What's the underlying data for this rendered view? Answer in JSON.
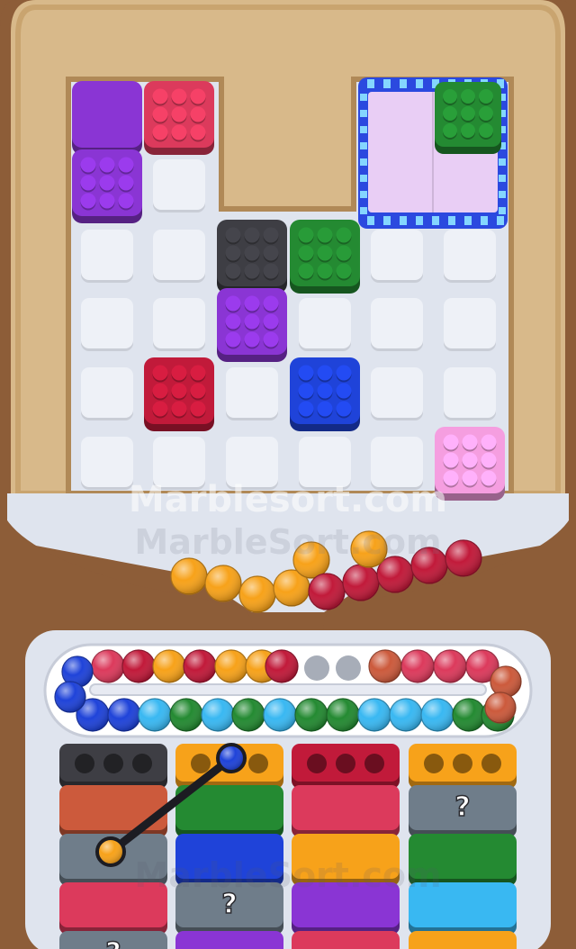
{
  "watermarks": {
    "primary": "Marblesort.com",
    "secondary": "MarbleSort.com",
    "bottom": "MarbleSort.com"
  },
  "colors": {
    "wood": "#8d5d38",
    "tray": "#d8b98a",
    "floor": "#dfe4ee",
    "empty_cell": "#eef1f7",
    "purple": "#8a35d4",
    "red": "#dc3a5c",
    "crimson": "#c11a3a",
    "green": "#248a32",
    "black": "#3e3e44",
    "blue": "#1f43d9",
    "pink": "#f59ee0",
    "lavender": "#e9cef5",
    "stripe_blue": "#2b49df",
    "stripe_light": "#84d6ff",
    "orange": "#f7a21a",
    "light_blue": "#39b8f2",
    "brick": "#cc5a3c",
    "gray": "#6f7d8a",
    "dark_slot": "#3c3c44"
  },
  "grid_board": {
    "tiles": [
      {
        "row": 0,
        "col": 0,
        "color": "purple",
        "studs": false
      },
      {
        "row": 0,
        "col": 1,
        "color": "red",
        "studs": true
      },
      {
        "row": 1,
        "col": 0,
        "color": "purple",
        "studs": true
      },
      {
        "row": 1,
        "col": 1,
        "color": "empty"
      },
      {
        "row": 2,
        "col": 0,
        "color": "empty"
      },
      {
        "row": 2,
        "col": 1,
        "color": "empty"
      },
      {
        "row": 2,
        "col": 2,
        "color": "black",
        "studs": true
      },
      {
        "row": 2,
        "col": 3,
        "color": "green",
        "studs": true
      },
      {
        "row": 2,
        "col": 4,
        "color": "empty"
      },
      {
        "row": 2,
        "col": 5,
        "color": "empty"
      },
      {
        "row": 3,
        "col": 0,
        "color": "empty"
      },
      {
        "row": 3,
        "col": 1,
        "color": "empty"
      },
      {
        "row": 3,
        "col": 2,
        "color": "purple",
        "studs": true
      },
      {
        "row": 3,
        "col": 3,
        "color": "empty"
      },
      {
        "row": 3,
        "col": 4,
        "color": "empty"
      },
      {
        "row": 3,
        "col": 5,
        "color": "empty"
      },
      {
        "row": 4,
        "col": 0,
        "color": "empty"
      },
      {
        "row": 4,
        "col": 1,
        "color": "crimson",
        "studs": true
      },
      {
        "row": 4,
        "col": 2,
        "color": "empty"
      },
      {
        "row": 4,
        "col": 3,
        "color": "blue",
        "studs": true
      },
      {
        "row": 4,
        "col": 4,
        "color": "empty"
      },
      {
        "row": 4,
        "col": 5,
        "color": "empty"
      },
      {
        "row": 5,
        "col": 0,
        "color": "empty"
      },
      {
        "row": 5,
        "col": 1,
        "color": "empty"
      },
      {
        "row": 5,
        "col": 2,
        "color": "empty"
      },
      {
        "row": 5,
        "col": 3,
        "color": "empty"
      },
      {
        "row": 5,
        "col": 4,
        "color": "empty"
      },
      {
        "row": 5,
        "col": 5,
        "color": "pink",
        "studs": true
      }
    ],
    "locked_box": {
      "top_right_tile": "green"
    }
  },
  "marble_hopper": {
    "balls": [
      "orange",
      "orange",
      "orange",
      "orange",
      "orange",
      "crimson",
      "crimson",
      "crimson",
      "crimson",
      "crimson",
      "orange",
      "orange"
    ]
  },
  "conveyor": {
    "top_row": [
      "red",
      "crimson",
      "orange",
      "crimson",
      "orange",
      "orange",
      "crimson",
      "empty",
      "empty",
      "brick",
      "red",
      "red",
      "red"
    ],
    "bottom_row": [
      "blue",
      "blue",
      "light_blue",
      "green",
      "light_blue",
      "green",
      "light_blue",
      "green",
      "green",
      "light_blue",
      "light_blue",
      "light_blue",
      "green",
      "green"
    ],
    "left_turn": [
      "blue",
      "blue"
    ],
    "right_turn": [
      "brick",
      "brick"
    ]
  },
  "columns": [
    {
      "id": "col-1",
      "slot_color": "black",
      "blocks": [
        "brick",
        "gray",
        "red",
        "gray"
      ],
      "hidden": [
        false,
        false,
        false,
        true
      ]
    },
    {
      "id": "col-2",
      "slot_color": "orange",
      "blocks": [
        "green",
        "blue",
        "gray",
        "purple"
      ],
      "hidden": [
        false,
        false,
        true,
        false
      ]
    },
    {
      "id": "col-3",
      "slot_color": "crimson",
      "blocks": [
        "red",
        "orange",
        "purple",
        "red"
      ],
      "hidden": [
        false,
        false,
        false,
        false
      ]
    },
    {
      "id": "col-4",
      "slot_color": "orange",
      "blocks": [
        "gray",
        "green",
        "light_blue",
        "orange"
      ],
      "hidden": [
        true,
        false,
        false,
        false
      ]
    }
  ],
  "hidden_label": "?",
  "link_rope": {
    "color": "#1c1c22",
    "start_ball": "blue",
    "end_ball": "orange"
  }
}
